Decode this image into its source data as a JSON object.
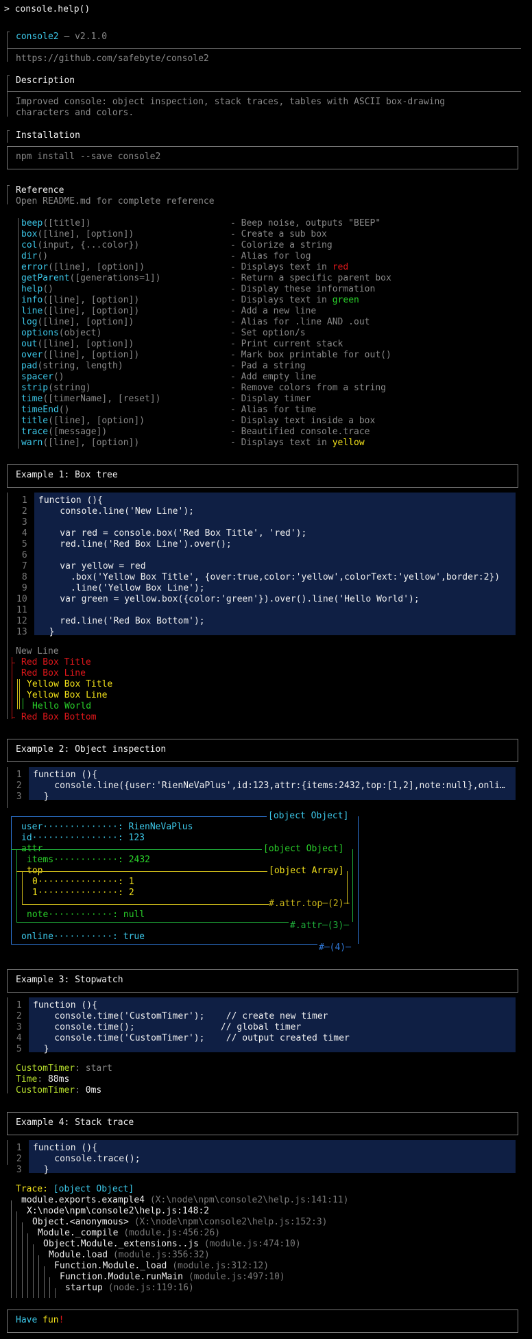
{
  "prompt": "> console.help()",
  "title": {
    "name": "console2",
    "version": " — v2.1.0",
    "url": "https://github.com/safebyte/console2"
  },
  "description": {
    "heading": "Description",
    "text1": "Improved console: object inspection, stack traces, tables with ASCII box-drawing",
    "text2": "characters and colors."
  },
  "installation": {
    "heading": "Installation",
    "command": "npm install --save console2"
  },
  "reference": {
    "heading": "Reference",
    "note": "Open README.md for complete reference",
    "items": [
      {
        "name": "beep",
        "sig": "([title])",
        "desc": "- Beep noise, outputs \"BEEP\""
      },
      {
        "name": "box",
        "sig": "([line], [option])",
        "desc": "- Create a sub box"
      },
      {
        "name": "col",
        "sig": "(input, {...color})",
        "desc": "- Colorize a string"
      },
      {
        "name": "dir",
        "sig": "()",
        "desc": "- Alias for log"
      },
      {
        "name": "error",
        "sig": "([line], [option])",
        "desc": "- Displays text in ",
        "hl": "red"
      },
      {
        "name": "getParent",
        "sig": "([generations=1])",
        "desc": "- Return a specific parent box"
      },
      {
        "name": "help",
        "sig": "()",
        "desc": "- Display these information"
      },
      {
        "name": "info",
        "sig": "([line], [option])",
        "desc": "- Displays text in ",
        "hl": "green"
      },
      {
        "name": "line",
        "sig": "([line], [option])",
        "desc": "- Add a new line"
      },
      {
        "name": "log",
        "sig": "([line], [option])",
        "desc": "- Alias for .line AND .out"
      },
      {
        "name": "options",
        "sig": "(object)",
        "desc": "- Set option/s"
      },
      {
        "name": "out",
        "sig": "([line], [option])",
        "desc": "- Print current stack"
      },
      {
        "name": "over",
        "sig": "([line], [option])",
        "desc": "- Mark box printable for out()"
      },
      {
        "name": "pad",
        "sig": "(string, length)",
        "desc": "- Pad a string"
      },
      {
        "name": "spacer",
        "sig": "()",
        "desc": "- Add empty line"
      },
      {
        "name": "strip",
        "sig": "(string)",
        "desc": "- Remove colors from a string"
      },
      {
        "name": "time",
        "sig": "([timerName], [reset])",
        "desc": "- Display timer"
      },
      {
        "name": "timeEnd",
        "sig": "()",
        "desc": "- Alias for time"
      },
      {
        "name": "title",
        "sig": "([line], [option])",
        "desc": "- Display text inside a box"
      },
      {
        "name": "trace",
        "sig": "([message])",
        "desc": "- Beautified console.trace"
      },
      {
        "name": "warn",
        "sig": "([line], [option])",
        "desc": "- Displays text in ",
        "hl": "yellow"
      }
    ]
  },
  "example1": {
    "heading": "Example 1: Box tree",
    "lines": [
      "function (){",
      "    console.line('New Line');",
      "",
      "    var red = console.box('Red Box Title', 'red');",
      "    red.line('Red Box Line').over();",
      "",
      "    var yellow = red",
      "      .box('Yellow Box Title', {over:true,color:'yellow',colorText:'yellow',border:2})",
      "      .line('Yellow Box Line');",
      "    var green = yellow.box({color:'green'}).over().line('Hello World');",
      "",
      "    red.line('Red Box Bottom');",
      "  }"
    ],
    "out": {
      "newline": "New Line",
      "redTitle": "Red Box Title",
      "redLine": "Red Box Line",
      "yellowTitle": "Yellow Box Title",
      "yellowLine": "Yellow Box Line",
      "hello": "Hello World",
      "redBottom": "Red Box Bottom"
    }
  },
  "example2": {
    "heading": "Example 2: Object inspection",
    "lines": [
      "function (){",
      "    console.line({user:'RienNeVaPlus',id:123,attr:{items:2432,top:[1,2],note:null},onli…",
      "  }"
    ],
    "tree": {
      "objectLabel": "[object Object]",
      "user": "user··············: RienNeVaPlus",
      "id": "id················: 123",
      "attr": "attr",
      "attrLabel": "[object Object]",
      "items": "items············: 2432",
      "top": "top",
      "topLabel": "[object Array]",
      "zero": "0···············: 1",
      "one": "1···············: 2",
      "topEnd": "#.attr.top─(2)─",
      "note": "note············: null",
      "attrEnd": "#.attr─(3)─",
      "online": "online···········: true",
      "rootEnd": "#─(4)─"
    }
  },
  "example3": {
    "heading": "Example 3: Stopwatch",
    "lines": [
      "function (){",
      "    console.time('CustomTimer');    // create new timer",
      "    console.time();                // global timer",
      "    console.time('CustomTimer');    // output created timer",
      "  }"
    ],
    "out": {
      "t1": "CustomTimer",
      "t1v": ": start",
      "t2": "Time",
      "t2v": "88ms",
      "t3": "CustomTimer",
      "t3v": "0ms"
    }
  },
  "example4": {
    "heading": "Example 4: Stack trace",
    "lines": [
      "function (){",
      "    console.trace();",
      "  }"
    ],
    "trace": {
      "label": "Trace:",
      "obj": "[object Object]",
      "frames": [
        {
          "fn": "module.exports.example4",
          "loc": "(X:\\node\\npm\\console2\\help.js:141:11)"
        },
        {
          "fn": "X:\\node\\npm\\console2\\help.js:148:2",
          "loc": ""
        },
        {
          "fn": "Object.<anonymous>",
          "loc": "(X:\\node\\npm\\console2\\help.js:152:3)"
        },
        {
          "fn": "Module._compile",
          "loc": "(module.js:456:26)"
        },
        {
          "fn": "Object.Module._extensions..js",
          "loc": "(module.js:474:10)"
        },
        {
          "fn": "Module.load",
          "loc": "(module.js:356:32)"
        },
        {
          "fn": "Function.Module._load",
          "loc": "(module.js:312:12)"
        },
        {
          "fn": "Function.Module.runMain",
          "loc": "(module.js:497:10)"
        },
        {
          "fn": "startup",
          "loc": "(node.js:119:16)"
        }
      ]
    }
  },
  "footer": {
    "have": "Have",
    "fun": "fun",
    "bang": "!"
  }
}
